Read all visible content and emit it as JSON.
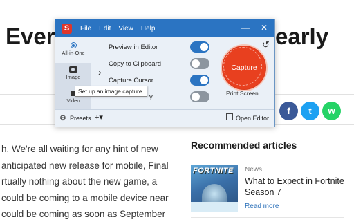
{
  "article": {
    "headline_left": "Ever",
    "headline_right": "early",
    "body_lines": [
      "h. We're all waiting for any hint of new",
      "anticipated new release for mobile, Final",
      "rtually nothing about the new game, a",
      "could be coming to a mobile device near",
      " could be coming as soon as September"
    ],
    "share": {
      "facebook": "f",
      "twitter": "t",
      "whatsapp": "w"
    }
  },
  "recommended": {
    "title": "Recommended articles",
    "item": {
      "thumb_text": "FORTNITE",
      "category": "News",
      "headline": "What to Expect in Fortnite Season 7",
      "link": "Read more"
    }
  },
  "snagit": {
    "logo": "S",
    "menu": [
      "File",
      "Edit",
      "View",
      "Help"
    ],
    "window_controls": {
      "minimize": "—",
      "close": "✕"
    },
    "modes": [
      {
        "label": "All-in-One",
        "icon": "radio-selected-icon"
      },
      {
        "label": "Image",
        "icon": "camera-icon"
      },
      {
        "label": "Video",
        "icon": "video-icon"
      }
    ],
    "options": [
      {
        "label": "Preview in Editor",
        "on": true
      },
      {
        "label": "Copy to Clipboard",
        "on": false
      },
      {
        "label": "Capture Cursor",
        "on": true
      },
      {
        "label": "y",
        "on": false
      }
    ],
    "capture_label": "Capture",
    "shortcut": "Print Screen",
    "presets_label": "Presets",
    "open_editor_label": "Open Editor",
    "tooltip": "Set up an image capture.",
    "colors": {
      "titlebar": "#2b74c2",
      "capture": "#e8401f"
    }
  }
}
